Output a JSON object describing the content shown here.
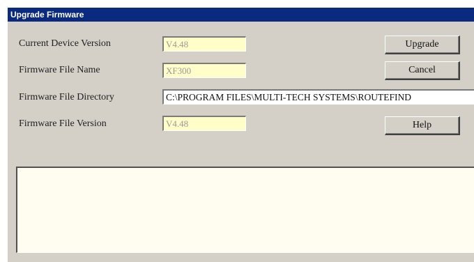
{
  "window": {
    "title": "Upgrade Firmware"
  },
  "fields": {
    "current_device_version": {
      "label": "Current Device Version",
      "value": "V4.48"
    },
    "firmware_file_name": {
      "label": "Firmware File Name",
      "value": "XF300"
    },
    "firmware_file_directory": {
      "label": "Firmware File Directory",
      "value": "C:\\PROGRAM FILES\\MULTI-TECH SYSTEMS\\ROUTEFIND"
    },
    "firmware_file_version": {
      "label": "Firmware File Version",
      "value": "V4.48"
    }
  },
  "buttons": {
    "upgrade": "Upgrade",
    "cancel": "Cancel",
    "help": "Help"
  },
  "log": {
    "text": ""
  },
  "colors": {
    "titlebar": "#0a2a80",
    "dialog_bg": "#d4d0c8",
    "field_bg": "#fffdc8",
    "log_bg": "#fffdf0"
  }
}
